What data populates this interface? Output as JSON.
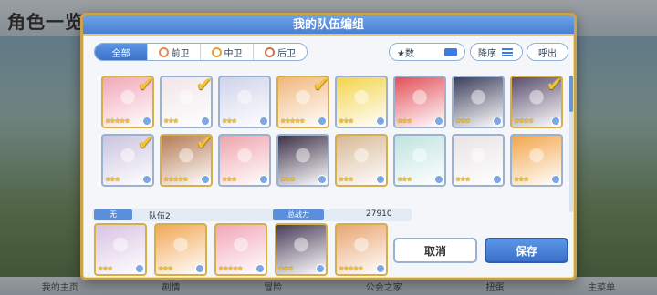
{
  "background": {
    "title": "角色一览",
    "bottom_nav": [
      "我的主页",
      "剧情",
      "冒险",
      "公会之家",
      "扭蛋",
      "主菜单"
    ]
  },
  "dialog": {
    "title": "我的队伍编组",
    "tabs": [
      {
        "label": "全部",
        "active": true
      },
      {
        "label": "前卫",
        "icon": "vanguard-icon"
      },
      {
        "label": "中卫",
        "icon": "midguard-icon"
      },
      {
        "label": "后卫",
        "icon": "rearguard-icon"
      }
    ],
    "sort_label": "★数",
    "order_label": "降序",
    "call_label": "呼出"
  },
  "roster": {
    "cards": [
      {
        "stars": "★★★★★",
        "checked": true,
        "gold": true,
        "color": "#f2a6b8"
      },
      {
        "stars": "★★★",
        "checked": true,
        "gold": false,
        "color": "#f1e5e8"
      },
      {
        "stars": "★★★",
        "checked": false,
        "gold": false,
        "color": "#cfd3ea"
      },
      {
        "stars": "★★★★★",
        "checked": true,
        "gold": true,
        "color": "#f1b67b"
      },
      {
        "stars": "★★★",
        "checked": false,
        "gold": false,
        "color": "#f3d44a"
      },
      {
        "stars": "★★★",
        "checked": false,
        "gold": false,
        "color": "#e3505a"
      },
      {
        "stars": "★★★",
        "checked": false,
        "gold": false,
        "color": "#3b3f5c"
      },
      {
        "stars": "★★★★",
        "checked": true,
        "gold": true,
        "color": "#5b4e6e"
      },
      {
        "stars": "★★★",
        "checked": true,
        "gold": false,
        "color": "#cbc3e0"
      },
      {
        "stars": "★★★★★",
        "checked": true,
        "gold": true,
        "color": "#b57a55"
      },
      {
        "stars": "★★★",
        "checked": false,
        "gold": false,
        "color": "#f0a3ad"
      },
      {
        "stars": "★★★",
        "checked": false,
        "gold": false,
        "color": "#3d3048"
      },
      {
        "stars": "★★★",
        "checked": false,
        "gold": true,
        "color": "#d8b895"
      },
      {
        "stars": "★★★",
        "checked": false,
        "gold": false,
        "color": "#bfe3e0"
      },
      {
        "stars": "★★★",
        "checked": false,
        "gold": false,
        "color": "#e8e3e6"
      },
      {
        "stars": "★★★",
        "checked": false,
        "gold": false,
        "color": "#f3a54a"
      }
    ]
  },
  "team": {
    "tag": "无",
    "name": "队伍2",
    "power_label": "总战力",
    "power_value": "27910",
    "members": [
      {
        "stars": "★★★",
        "color": "#d9c2e3"
      },
      {
        "stars": "★★★",
        "color": "#f2a755"
      },
      {
        "stars": "★★★★★",
        "color": "#f2a6b8"
      },
      {
        "stars": "★★★",
        "color": "#4a3d58"
      },
      {
        "stars": "★★★★★",
        "color": "#e8a570"
      }
    ]
  },
  "buttons": {
    "cancel": "取消",
    "save": "保存"
  }
}
